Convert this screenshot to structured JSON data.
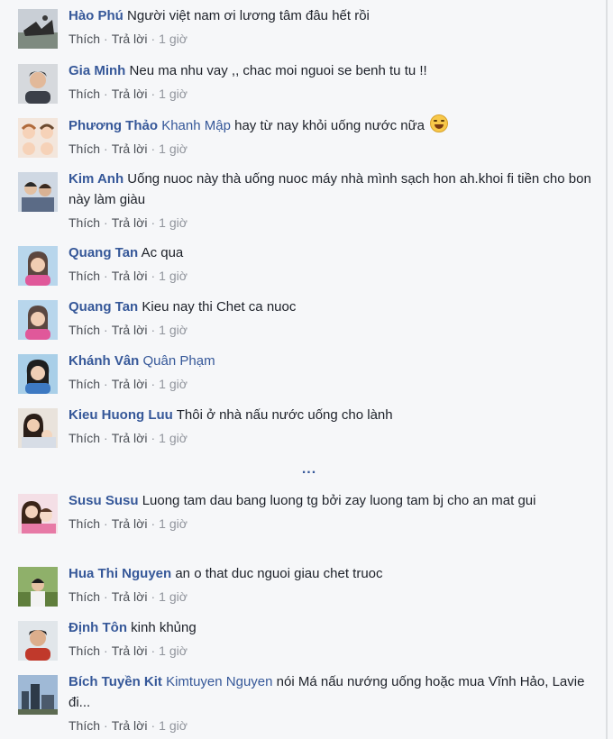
{
  "actions": {
    "like": "Thích",
    "reply": "Trả lời",
    "dot": "·"
  },
  "more_indicator": "...",
  "comments": [
    {
      "name": "Hào Phú",
      "text": "Người việt nam ơi lương tâm đâu hết rồi",
      "time": "1 giờ",
      "avatar": "avatar-birds"
    },
    {
      "name": "Gia Minh",
      "text": "Neu ma nhu vay ,, chac moi nguoi se benh tu tu !!",
      "time": "1 giờ",
      "avatar": "avatar-man"
    },
    {
      "name": "Phương Thảo",
      "tag": "Khanh Mập",
      "text": "hay từ nay khỏi uống nước nữa",
      "emoji": "laughing-emoji",
      "time": "1 giờ",
      "avatar": "avatar-cartoon"
    },
    {
      "name": "Kim Anh",
      "text": "Uống nuoc này thà uống nuoc máy nhà mình sạch hon ah.khoi fi tiền cho bon này làm giàu",
      "time": "1 giờ",
      "avatar": "avatar-couple"
    },
    {
      "name": "Quang Tan",
      "text": "Ac qua",
      "time": "1 giờ",
      "avatar": "avatar-girl-pink"
    },
    {
      "name": "Quang Tan",
      "text": "Kieu nay thi Chet ca nuoc",
      "time": "1 giờ",
      "avatar": "avatar-girl-pink"
    },
    {
      "name": "Khánh Vân",
      "tag": "Quân Phạm",
      "text": "",
      "time": "1 giờ",
      "avatar": "avatar-woman-blue"
    },
    {
      "name": "Kieu Huong Luu",
      "text": "Thôi ở nhà nấu nước uống cho lành",
      "time": "1 giờ",
      "avatar": "avatar-mother-child"
    },
    {
      "name": "Susu Susu",
      "text": "Luong tam dau bang luong tg bởi zay luong tam bj cho an mat gui",
      "time": "1 giờ",
      "avatar": "avatar-kids"
    },
    {
      "name": "Hua Thi Nguyen",
      "text": "an o that duc nguoi giau chet truoc",
      "time": "1 giờ",
      "avatar": "avatar-outdoor"
    },
    {
      "name": "Định Tôn",
      "text": "kinh khủng",
      "time": "1 giờ",
      "avatar": "avatar-young-man"
    },
    {
      "name": "Bích Tuyền Kit",
      "tag": "Kimtuyen Nguyen",
      "text": "nói Má nấu nướng uống hoặc mua Vĩnh Hảo, Lavie đi...",
      "time": "1 giờ",
      "avatar": "avatar-city"
    }
  ]
}
